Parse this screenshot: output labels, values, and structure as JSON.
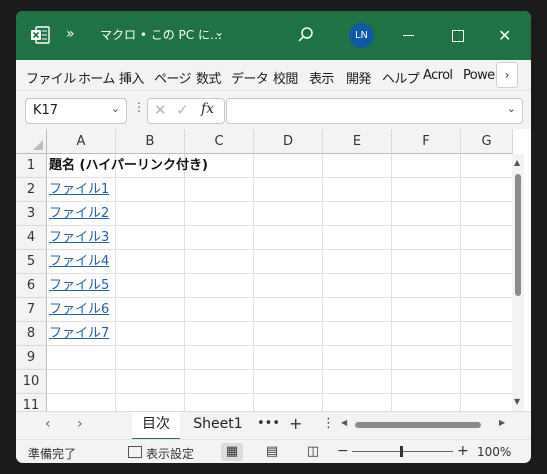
{
  "titlebar": {
    "title": "マクロ • この PC に…",
    "avatar_initials": "LN",
    "accent": "#1f7244"
  },
  "ribbon": {
    "tabs": [
      "ファイル",
      "ホーム",
      "挿入",
      "ページ",
      "数式",
      "データ",
      "校閲",
      "表示",
      "開発",
      "ヘルプ",
      "Acrol",
      "Powe"
    ]
  },
  "formula_bar": {
    "name_box": "K17",
    "fx_label": "fx",
    "formula": ""
  },
  "grid": {
    "columns": [
      "A",
      "B",
      "C",
      "D",
      "E",
      "F",
      "G"
    ],
    "rows": [
      "1",
      "2",
      "3",
      "4",
      "5",
      "6",
      "7",
      "8",
      "9",
      "10",
      "11"
    ],
    "cells": {
      "A1": "題名 (ハイパーリンク付き)",
      "A2": "ファイル1",
      "A3": "ファイル2",
      "A4": "ファイル3",
      "A5": "ファイル4",
      "A6": "ファイル5",
      "A7": "ファイル6",
      "A8": "ファイル7"
    },
    "link_color": "#2460a7"
  },
  "sheet_tabs": {
    "tabs": [
      "目次",
      "Sheet1"
    ],
    "active": "目次",
    "more_label": "•••"
  },
  "status_bar": {
    "ready": "準備完了",
    "display_settings": "表示設定",
    "zoom": "100%"
  }
}
